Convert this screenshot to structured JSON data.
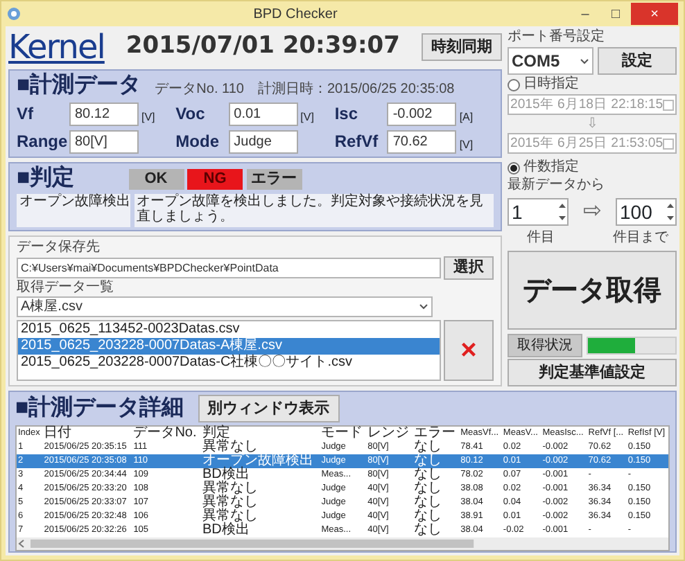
{
  "window": {
    "title": "BPD Checker",
    "controls": [
      {
        "label": "–",
        "kind": "minimize"
      },
      {
        "label": "□",
        "kind": "maximize"
      },
      {
        "label": "×",
        "kind": "close"
      }
    ]
  },
  "logo": "Kernel",
  "clock": "2015/07/01 20:39:07",
  "sync_button": "時刻同期",
  "measurement": {
    "title": "■計測データ",
    "data_no": "データNo. 110",
    "measured_at": "計測日時：2015/06/25 20:35:08",
    "fields": [
      {
        "label": "Vf",
        "value": "80.12",
        "unit": "[V]"
      },
      {
        "label": "Voc",
        "value": "0.01",
        "unit": "[V]"
      },
      {
        "label": "Isc",
        "value": "-0.002",
        "unit": "[A]"
      },
      {
        "label": "Range",
        "value": "80[V]"
      },
      {
        "label": "Mode",
        "value": "Judge"
      },
      {
        "label": "RefVf",
        "value": "70.62",
        "unit": "[V]"
      }
    ]
  },
  "judgment": {
    "title": "■判定",
    "results": [
      {
        "label": "OK",
        "selected": false
      },
      {
        "label": "NG",
        "selected": true
      },
      {
        "label": "エラー",
        "selected": false
      }
    ],
    "result_text": "オープン故障検出",
    "message": "オープン故障を検出しました。判定対象や接続状況を見直しましょう。"
  },
  "storage": {
    "label": "データ保存先",
    "path": "C:¥Users¥mai¥Documents¥BPDChecker¥PointData",
    "select_button": "選択"
  },
  "files": {
    "label": "取得データ一覧",
    "filter": "A棟屋.csv",
    "delete_button": "×",
    "items": [
      {
        "name": "2015_0625_113452-0023Datas.csv",
        "selected": false
      },
      {
        "name": "2015_0625_203228-0007Datas-A棟屋.csv",
        "selected": true
      },
      {
        "name": "2015_0625_203228-0007Datas-C社棟〇〇サイト.csv",
        "selected": false
      }
    ]
  },
  "port": {
    "label": "ポート番号設定",
    "value": "COM5",
    "set_button": "設定"
  },
  "range_by_date": {
    "label": "日時指定",
    "selected": false,
    "from": "2015年 6月18日 22:18:15",
    "arrow": "⇩",
    "to": "2015年 6月25日 21:53:05"
  },
  "range_by_count": {
    "label": "件数指定",
    "selected": true,
    "sublabel": "最新データから",
    "from": "1",
    "arrow": "⇨",
    "to": "100",
    "from_label": "件目",
    "to_label": "件目まで"
  },
  "fetch_button": "データ取得",
  "status": {
    "label": "取得状況",
    "level": 0.55
  },
  "criteria_button": "判定基準値設定",
  "details": {
    "title": "■計測データ詳細",
    "popout_button": "別ウィンドウ表示",
    "columns": [
      "Index",
      "日付",
      "データNo.",
      "判定",
      "モード",
      "レンジ",
      "エラー",
      "MeasVf...",
      "MeasV...",
      "MeasIsc...",
      "RefVf [...",
      "RefIsf [V]"
    ],
    "rows": [
      {
        "selected": false,
        "cells": [
          "1",
          "2015/06/25 20:35:15",
          "111",
          "異常なし",
          "Judge",
          "80[V]",
          "なし",
          "78.41",
          "0.02",
          "-0.002",
          "70.62",
          "0.150"
        ]
      },
      {
        "selected": true,
        "cells": [
          "2",
          "2015/06/25 20:35:08",
          "110",
          "オープン故障検出",
          "Judge",
          "80[V]",
          "なし",
          "80.12",
          "0.01",
          "-0.002",
          "70.62",
          "0.150"
        ]
      },
      {
        "selected": false,
        "cells": [
          "3",
          "2015/06/25 20:34:44",
          "109",
          "BD検出",
          "Meas...",
          "80[V]",
          "なし",
          "78.02",
          "0.07",
          "-0.001",
          "-",
          "-"
        ]
      },
      {
        "selected": false,
        "cells": [
          "4",
          "2015/06/25 20:33:20",
          "108",
          "異常なし",
          "Judge",
          "40[V]",
          "なし",
          "38.08",
          "0.02",
          "-0.001",
          "36.34",
          "0.150"
        ]
      },
      {
        "selected": false,
        "cells": [
          "5",
          "2015/06/25 20:33:07",
          "107",
          "異常なし",
          "Judge",
          "40[V]",
          "なし",
          "38.04",
          "0.04",
          "-0.002",
          "36.34",
          "0.150"
        ]
      },
      {
        "selected": false,
        "cells": [
          "6",
          "2015/06/25 20:32:48",
          "106",
          "異常なし",
          "Judge",
          "40[V]",
          "なし",
          "38.91",
          "0.01",
          "-0.002",
          "36.34",
          "0.150"
        ]
      },
      {
        "selected": false,
        "cells": [
          "7",
          "2015/06/25 20:32:26",
          "105",
          "BD検出",
          "Meas...",
          "40[V]",
          "なし",
          "38.04",
          "-0.02",
          "-0.001",
          "-",
          "-"
        ]
      }
    ]
  }
}
